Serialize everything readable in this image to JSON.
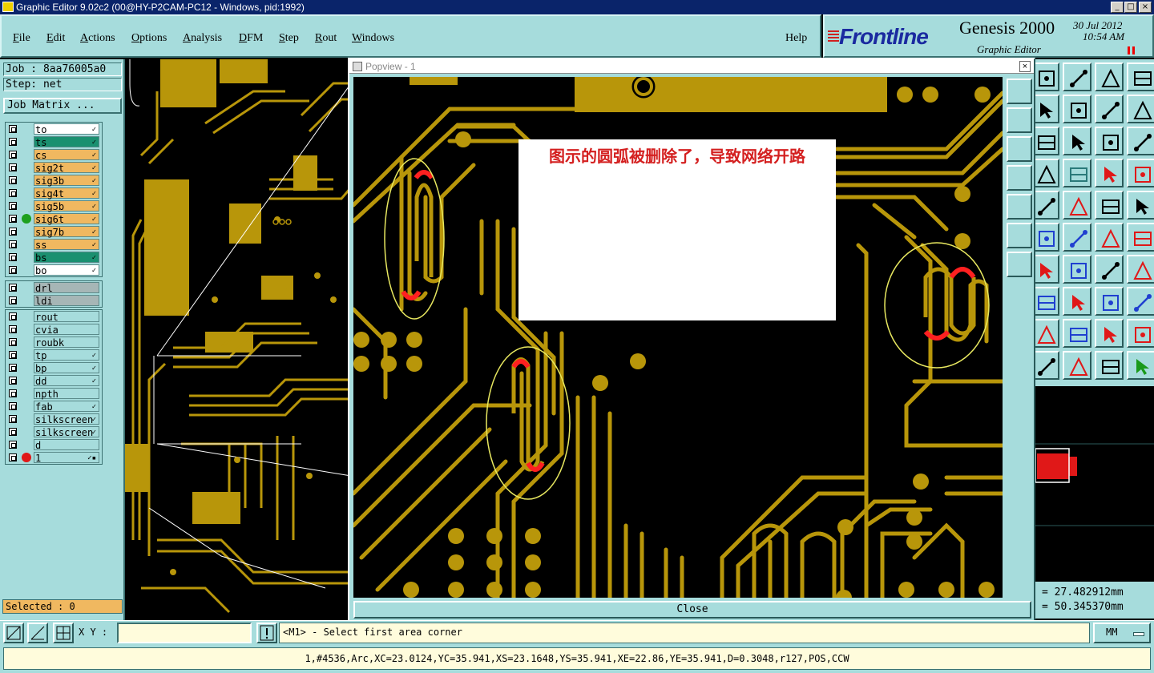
{
  "window": {
    "title": "Graphic Editor 9.02c2 (00@HY-P2CAM-PC12 - Windows, pid:1992)"
  },
  "menu": {
    "items": [
      {
        "label": "File",
        "u": "F",
        "rest": "ile"
      },
      {
        "label": "Edit",
        "u": "E",
        "rest": "dit"
      },
      {
        "label": "Actions",
        "u": "A",
        "rest": "ctions"
      },
      {
        "label": "Options",
        "u": "O",
        "rest": "ptions"
      },
      {
        "label": "Analysis",
        "u": "A",
        "rest": "nalysis"
      },
      {
        "label": "DFM",
        "u": "D",
        "rest": "FM"
      },
      {
        "label": "Step",
        "u": "S",
        "rest": "tep"
      },
      {
        "label": "Rout",
        "u": "R",
        "rest": "out"
      },
      {
        "label": "Windows",
        "u": "W",
        "rest": "indows"
      }
    ],
    "help": "Help"
  },
  "branding": {
    "company": "Frontline",
    "product": "Genesis 2000",
    "subtitle": "Graphic Editor",
    "date": "30 Jul 2012",
    "time": "10:54 AM"
  },
  "left_panel": {
    "job": "Job : 8aa76005a0",
    "step": "Step: net",
    "job_matrix": "Job Matrix ...",
    "layers_group1": [
      {
        "name": "to",
        "color": "#ffffff",
        "dot": "",
        "flag": "✓"
      },
      {
        "name": "ts",
        "color": "#1a9070",
        "dot": "",
        "flag": "✓"
      },
      {
        "name": "cs",
        "color": "#f0b860",
        "dot": "",
        "flag": "✓"
      },
      {
        "name": "sig2t",
        "color": "#f0b860",
        "dot": "",
        "flag": "✓"
      },
      {
        "name": "sig3b",
        "color": "#f0b860",
        "dot": "",
        "flag": "✓"
      },
      {
        "name": "sig4t",
        "color": "#f0b860",
        "dot": "",
        "flag": "✓"
      },
      {
        "name": "sig5b",
        "color": "#f0b860",
        "dot": "",
        "flag": "✓"
      },
      {
        "name": "sig6t",
        "color": "#f0b860",
        "dot": "#1ea01e",
        "flag": "✓"
      },
      {
        "name": "sig7b",
        "color": "#f0b860",
        "dot": "",
        "flag": "✓"
      },
      {
        "name": "ss",
        "color": "#f0b860",
        "dot": "",
        "flag": "✓"
      },
      {
        "name": "bs",
        "color": "#1a9070",
        "dot": "",
        "flag": "✓"
      },
      {
        "name": "bo",
        "color": "#ffffff",
        "dot": "",
        "flag": "✓"
      }
    ],
    "layers_group2": [
      {
        "name": "drl",
        "color": "#a6b6b6",
        "dot": "",
        "flag": ""
      },
      {
        "name": "ldi",
        "color": "#a6b6b6",
        "dot": "",
        "flag": ""
      }
    ],
    "layers_group3": [
      {
        "name": "rout",
        "color": "#a6dcdc",
        "dot": "",
        "flag": ""
      },
      {
        "name": "cvia",
        "color": "#a6dcdc",
        "dot": "",
        "flag": ""
      },
      {
        "name": "roubk",
        "color": "#a6dcdc",
        "dot": "",
        "flag": ""
      },
      {
        "name": "tp",
        "color": "#a6dcdc",
        "dot": "",
        "flag": "✓"
      },
      {
        "name": "bp",
        "color": "#a6dcdc",
        "dot": "",
        "flag": "✓"
      },
      {
        "name": "dd",
        "color": "#a6dcdc",
        "dot": "",
        "flag": "✓"
      },
      {
        "name": "npth",
        "color": "#a6dcdc",
        "dot": "",
        "flag": ""
      },
      {
        "name": "fab",
        "color": "#a6dcdc",
        "dot": "",
        "flag": "✓"
      },
      {
        "name": "silkscreen",
        "color": "#a6dcdc",
        "dot": "",
        "flag": "✓"
      },
      {
        "name": "silkscreen",
        "color": "#a6dcdc",
        "dot": "",
        "flag": "✓"
      },
      {
        "name": "d",
        "color": "#a6dcdc",
        "dot": "",
        "flag": ""
      },
      {
        "name": "1",
        "color": "#a6dcdc",
        "dot": "#e01818",
        "flag": "✓▪"
      }
    ],
    "selected": "Selected : 0"
  },
  "popup": {
    "title": "Popview - 1",
    "annotation": "图示的圆弧被删除了，导致网络开路",
    "close": "Close"
  },
  "coords": {
    "x": "= 27.482912mm",
    "y": "= 50.345370mm"
  },
  "command": {
    "xy_label": "X Y :",
    "xy_value": "",
    "prompt": "<M1> - Select first area corner",
    "units": "MM"
  },
  "status": {
    "line": "1,#4536,Arc,XC=23.0124,YC=35.941,XS=23.1648,YS=35.941,XE=22.86,YE=35.941,D=0.3048,r127,POS,CCW"
  },
  "colors": {
    "panel": "#a6dcdc",
    "trace": "#b8960a",
    "highlight": "#ff2020",
    "ellipse": "#e8e860"
  }
}
